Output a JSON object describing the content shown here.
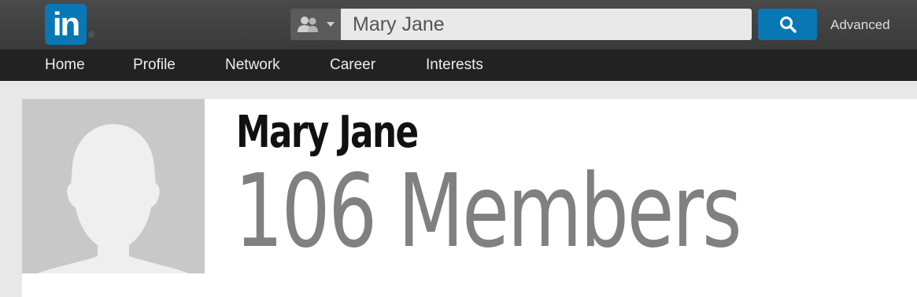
{
  "header": {
    "logo_text": "in",
    "logo_reg": "®",
    "search": {
      "people_icon": "people-icon",
      "value": "Mary Jane",
      "search_icon": "search-icon"
    },
    "advanced_label": "Advanced"
  },
  "nav": {
    "items": [
      {
        "label": "Home"
      },
      {
        "label": "Profile"
      },
      {
        "label": "Network"
      },
      {
        "label": "Career"
      },
      {
        "label": "Interests"
      }
    ]
  },
  "profile": {
    "avatar_icon": "person-silhouette-icon",
    "name": "Mary Jane",
    "members_text": "106 Members"
  },
  "colors": {
    "brand": "#0a77b5",
    "topbar": "#3f3f3f",
    "navbar": "#222222"
  }
}
